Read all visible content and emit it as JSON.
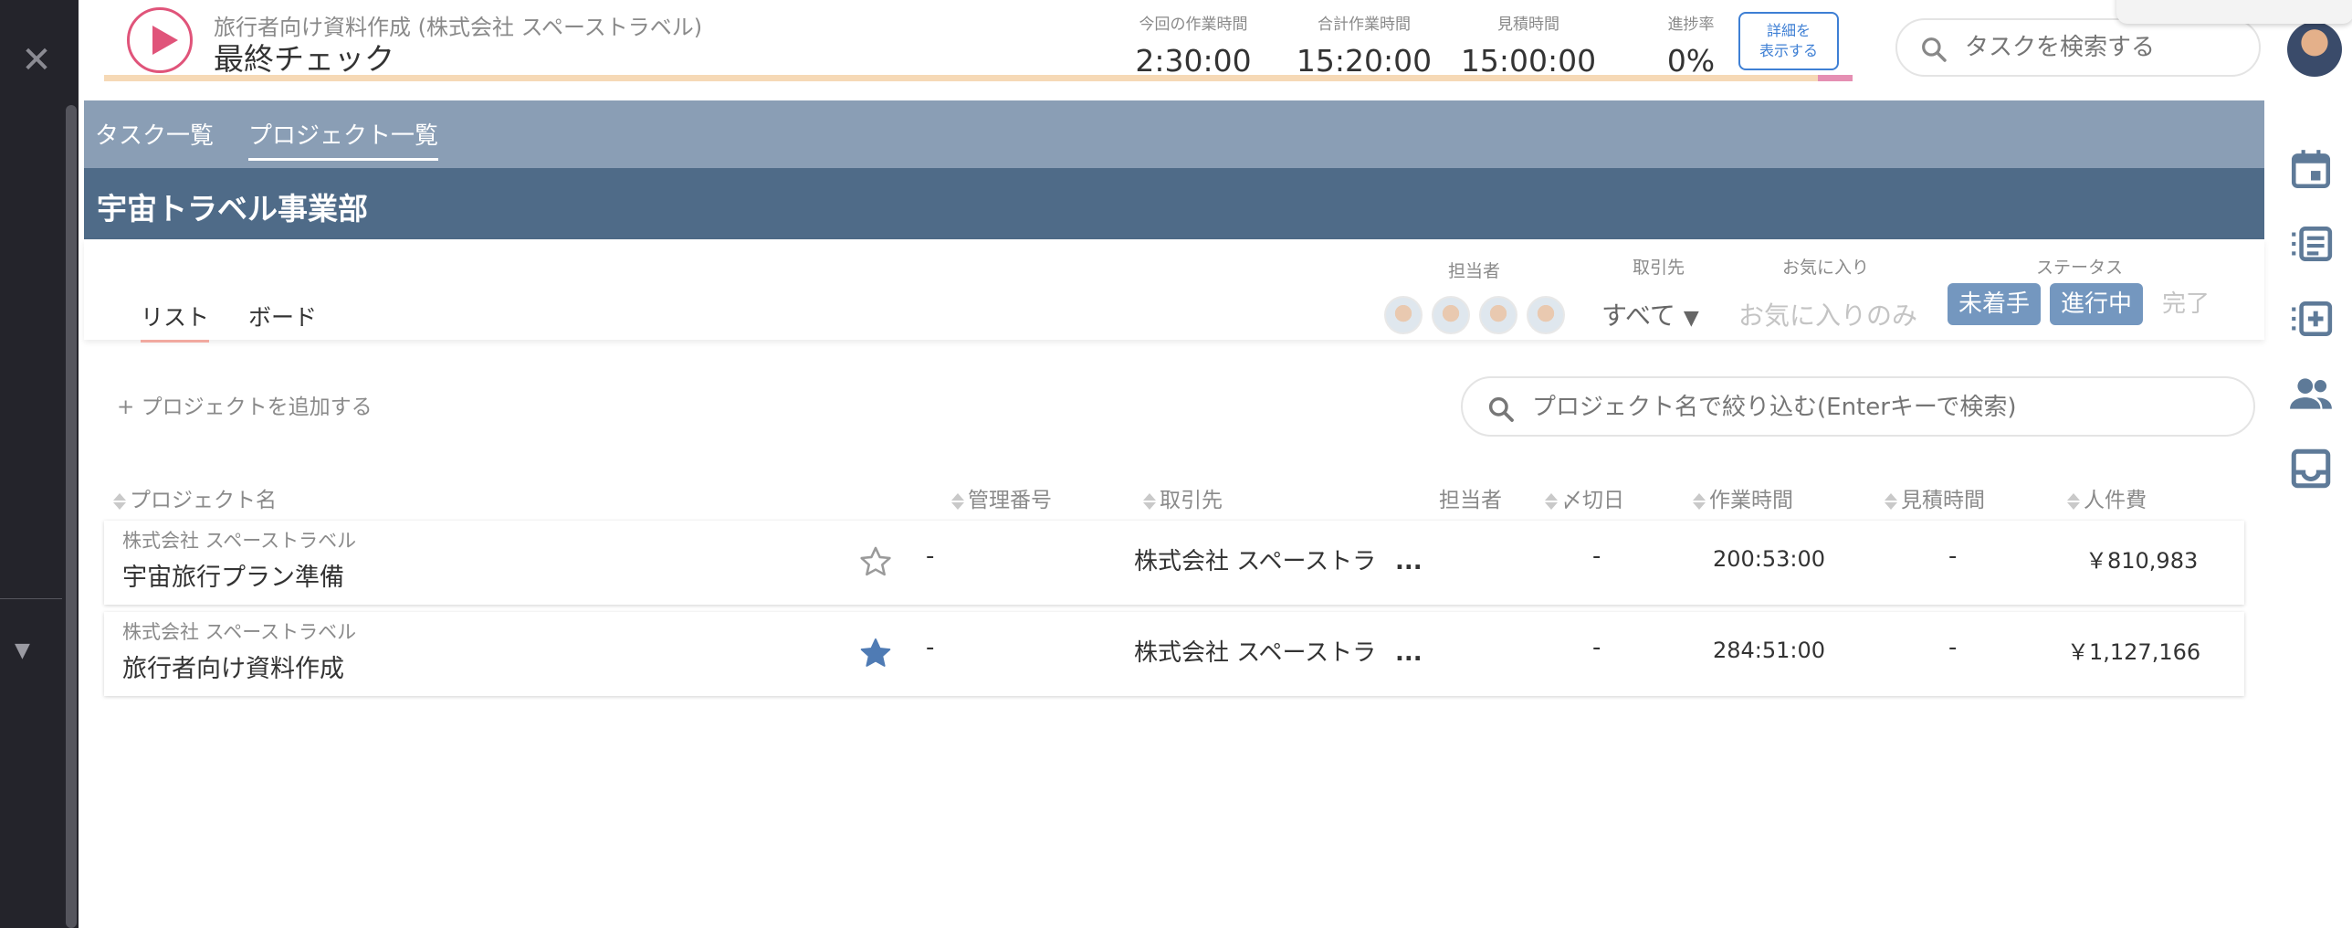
{
  "sidebar": {
    "close_glyph": "✕",
    "collapse_glyph": "▼"
  },
  "header": {
    "project_subtitle": "旅行者向け資料作成 (株式会社 スペーストラベル)",
    "task_title": "最終チェック",
    "stats": [
      {
        "label": "今回の作業時間",
        "value": "2:30:00"
      },
      {
        "label": "合計作業時間",
        "value": "15:20:00"
      },
      {
        "label": "見積時間",
        "value": "15:00:00"
      },
      {
        "label": "進捗率",
        "value": "0%"
      }
    ],
    "detail_button": {
      "line1": "詳細を",
      "line2": "表示する"
    },
    "progress_percent": 0,
    "task_search_placeholder": "タスクを検索する"
  },
  "nav_tabs": [
    {
      "label": "タスク一覧",
      "active": false
    },
    {
      "label": "プロジェクト一覧",
      "active": true
    }
  ],
  "department": "宇宙トラベル事業部",
  "view_tabs": [
    {
      "label": "リスト",
      "active": true
    },
    {
      "label": "ボード",
      "active": false
    }
  ],
  "filters": {
    "assignee_label": "担当者",
    "client_label": "取引先",
    "client_value": "すべて",
    "favorite_label": "お気に入り",
    "favorite_value": "お気に入りのみ",
    "status_label": "ステータス",
    "status_options": [
      {
        "label": "未着手",
        "selected": true
      },
      {
        "label": "進行中",
        "selected": true
      },
      {
        "label": "完了",
        "selected": false
      }
    ]
  },
  "add_project": "+ プロジェクトを追加する",
  "project_search_placeholder": "プロジェクト名で絞り込む(Enterキーで検索)",
  "table": {
    "headers": {
      "name": "プロジェクト名",
      "code": "管理番号",
      "client": "取引先",
      "assignee": "担当者",
      "deadline": "〆切日",
      "work_time": "作業時間",
      "estimate": "見積時間",
      "labor_cost": "人件費"
    },
    "rows": [
      {
        "client_small": "株式会社 スペーストラベル",
        "name": "宇宙旅行プラン準備",
        "favorite": false,
        "code": "-",
        "client": "株式会社 スペーストラ",
        "more": "...",
        "deadline": "-",
        "work_time": "200:53:00",
        "estimate": "-",
        "labor_cost": "￥810,983"
      },
      {
        "client_small": "株式会社 スペーストラベル",
        "name": "旅行者向け資料作成",
        "favorite": true,
        "code": "-",
        "client": "株式会社 スペーストラ",
        "more": "...",
        "deadline": "-",
        "work_time": "284:51:00",
        "estimate": "-",
        "labor_cost": "￥1,127,166"
      }
    ]
  },
  "colors": {
    "accent_play": "#e0547a",
    "nav_bar": "#8a9eb5",
    "dept_bar": "#4f6b88",
    "status_selected": "#7497bf",
    "star_filled": "#4f7bb4",
    "link_blue": "#3e7fd4"
  },
  "icons": [
    "play-icon",
    "search-icon",
    "calendar-icon",
    "task-list-icon",
    "add-task-icon",
    "people-icon",
    "inbox-icon",
    "star-icon"
  ]
}
